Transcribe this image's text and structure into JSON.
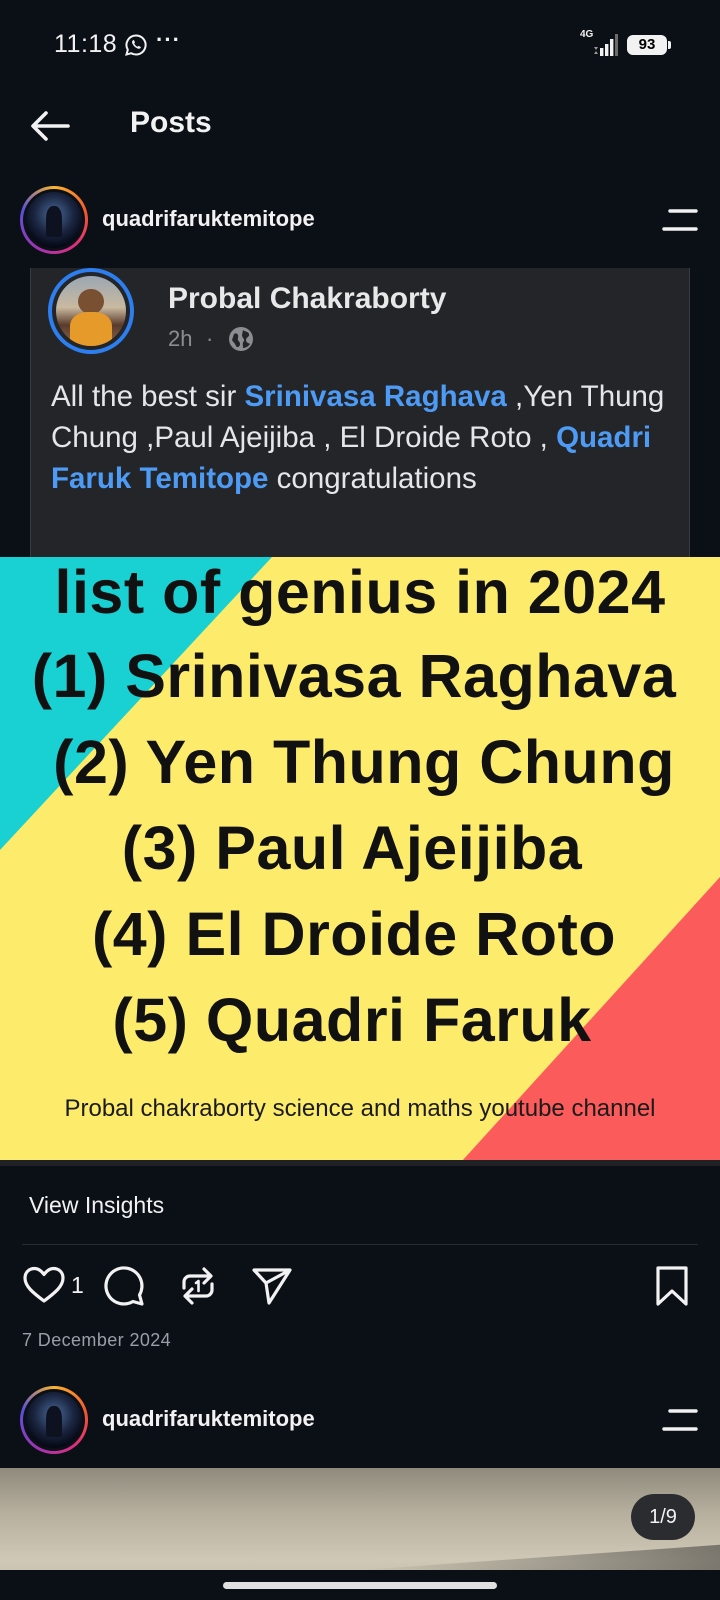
{
  "status_bar": {
    "time": "11:18",
    "more": "···",
    "network": "4G",
    "battery": "93"
  },
  "header": {
    "title": "Posts"
  },
  "post": {
    "username": "quadrifaruktemitope",
    "shared_card": {
      "author": "Probal Chakraborty",
      "time": "2h",
      "separator": "·",
      "text_before": "All the best sir ",
      "mention_1": "Srinivasa Raghava",
      "text_middle": " ,Yen Thung Chung ,Paul Ajeijiba , El Droide Roto , ",
      "mention_2": "Quadri Faruk Temitope",
      "text_after": " congratulations",
      "link_color": "#4d9bf5"
    },
    "graphic": {
      "lines": [
        "list of genius in 2024",
        "(1) Srinivasa Raghava",
        "(2) Yen Thung Chung",
        "(3) Paul Ajeijiba",
        "(4) El Droide Roto",
        "(5) Quadri Faruk"
      ],
      "footer": "Probal chakraborty science and maths youtube channel",
      "colors": {
        "teal": "#19d0d2",
        "yellow": "#fdeb6b",
        "coral": "#fb5b5b"
      }
    },
    "view_insights": "View Insights",
    "like_count": "1",
    "date": "7 December 2024"
  },
  "next_post": {
    "username": "quadrifaruktemitope",
    "page_indicator": "1/9"
  },
  "icons": {
    "whatsapp": "whatsapp-icon",
    "back": "back-arrow-icon",
    "more": "more-options-icon",
    "globe": "globe-icon",
    "like": "heart-icon",
    "comment": "comment-icon",
    "repost": "repost-icon",
    "share": "send-icon",
    "save": "bookmark-icon"
  }
}
